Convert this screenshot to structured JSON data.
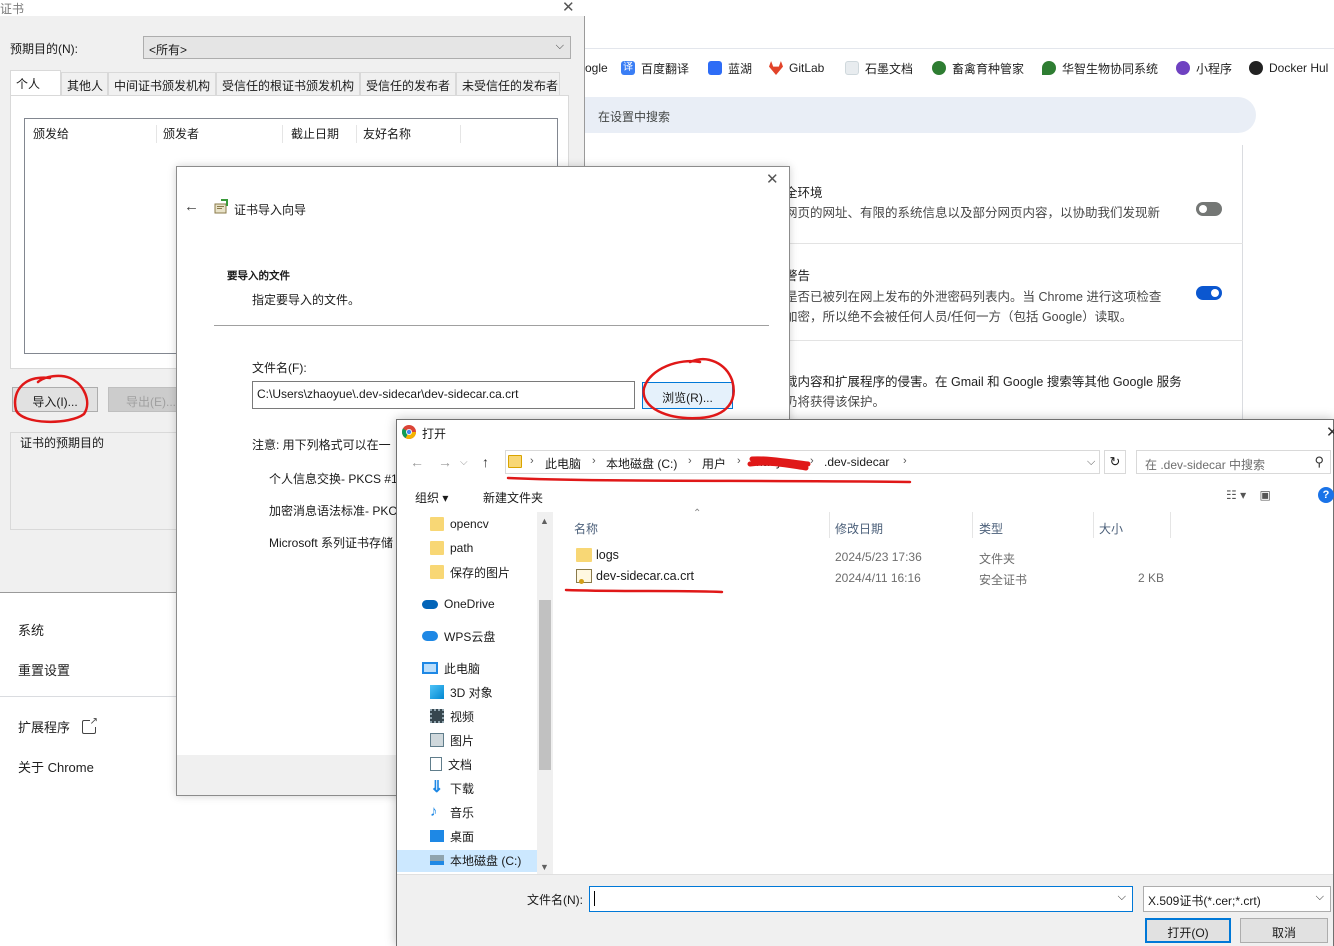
{
  "chrome": {
    "bookmarks": [
      {
        "label": "ogle",
        "icon": "google-icon",
        "color": "#ffffff"
      },
      {
        "label": "百度翻译",
        "icon": "translate-icon",
        "color": "#3a7ef5"
      },
      {
        "label": "蓝湖",
        "icon": "lanhu-icon",
        "color": "#2d6cf6"
      },
      {
        "label": "GitLab",
        "icon": "gitlab-icon",
        "color": "#e24329"
      },
      {
        "label": "石墨文档",
        "icon": "shimo-icon",
        "color": "#cfd8dc"
      },
      {
        "label": "畜禽育种管家",
        "icon": "globe-icon",
        "color": "#2e7d32"
      },
      {
        "label": "华智生物协同系统",
        "icon": "leaf-icon",
        "color": "#2e7d32"
      },
      {
        "label": "小程序",
        "icon": "miniapp-icon",
        "color": "#6f42c1"
      },
      {
        "label": "Docker Hul",
        "icon": "docker-icon",
        "color": "#222222"
      }
    ],
    "search_placeholder": "在设置中搜索",
    "safe_browsing_title": "全环境",
    "safe_browsing_desc": "网页的网址、有限的系统信息以及部分网页内容，以协助我们发现新",
    "password_title": "警告",
    "password_desc1": "是否已被列在网上发布的外泄密码列表内。当 Chrome 进行这项检查",
    "password_desc2": "加密，所以绝不会被任何人员/任何一方（包括 Google）读取。",
    "ext_desc1": "载内容和扩展程序的侵害。在 Gmail 和 Google 搜索等其他 Google 服务",
    "ext_desc2": "仍将获得该保护。",
    "toggle1_on": false,
    "toggle2_on": true,
    "accent": "#0b57d0",
    "nav": {
      "system": "系统",
      "reset": "重置设置",
      "extensions": "扩展程序",
      "about": "关于 Chrome"
    }
  },
  "cert_manager": {
    "title": "证书",
    "purpose_label": "预期目的(N):",
    "purpose_value": "<所有>",
    "tabs": [
      "个人",
      "其他人",
      "中间证书颁发机构",
      "受信任的根证书颁发机构",
      "受信任的发布者",
      "未受信任的发布者"
    ],
    "columns": [
      "颁发给",
      "颁发者",
      "截止日期",
      "友好名称"
    ],
    "import_btn": "导入(I)...",
    "export_btn": "导出(E)...",
    "purpose_group": "证书的预期目的"
  },
  "wizard": {
    "title": "证书导入向导",
    "heading": "要导入的文件",
    "sub": "指定要导入的文件。",
    "filename_label": "文件名(F):",
    "filename_value": "C:\\Users\\zhaoyue\\.dev-sidecar\\dev-sidecar.ca.crt",
    "browse_btn": "浏览(R)...",
    "note": "注意: 用下列格式可以在一",
    "formats": [
      "个人信息交换- PKCS #1",
      "加密消息语法标准- PKC",
      "Microsoft 系列证书存储"
    ]
  },
  "open_dialog": {
    "title": "打开",
    "breadcrumbs": [
      "此电脑",
      "本地磁盘 (C:)",
      "用户",
      "zhaoyue",
      ".dev-sidecar"
    ],
    "search_placeholder": "在 .dev-sidecar 中搜索",
    "organize": "组织 ▾",
    "new_folder": "新建文件夹",
    "nav_items": [
      {
        "label": "opencv",
        "icon": "folder-icon"
      },
      {
        "label": "path",
        "icon": "folder-icon"
      },
      {
        "label": "保存的图片",
        "icon": "folder-icon"
      },
      {
        "label": "OneDrive",
        "icon": "onedrive-icon"
      },
      {
        "label": "WPS云盘",
        "icon": "wps-cloud-icon"
      },
      {
        "label": "此电脑",
        "icon": "computer-icon"
      },
      {
        "label": "3D 对象",
        "icon": "3d-objects-icon"
      },
      {
        "label": "视频",
        "icon": "video-icon"
      },
      {
        "label": "图片",
        "icon": "pictures-icon"
      },
      {
        "label": "文档",
        "icon": "documents-icon"
      },
      {
        "label": "下载",
        "icon": "download-icon"
      },
      {
        "label": "音乐",
        "icon": "music-icon"
      },
      {
        "label": "桌面",
        "icon": "desktop-icon"
      },
      {
        "label": "本地磁盘 (C:)",
        "icon": "drive-icon"
      }
    ],
    "columns": [
      "名称",
      "修改日期",
      "类型",
      "大小"
    ],
    "files": [
      {
        "name": "logs",
        "date": "2024/5/23 17:36",
        "type": "文件夹",
        "size": "",
        "icon": "folder-icon"
      },
      {
        "name": "dev-sidecar.ca.crt",
        "date": "2024/4/11 16:16",
        "type": "安全证书",
        "size": "2 KB",
        "icon": "certificate-icon"
      }
    ],
    "filename_label": "文件名(N):",
    "filename_value": "",
    "filetype": "X.509证书(*.cer;*.crt)",
    "open_btn": "打开(O)",
    "cancel_btn": "取消"
  },
  "annotation_color": "#e01818"
}
